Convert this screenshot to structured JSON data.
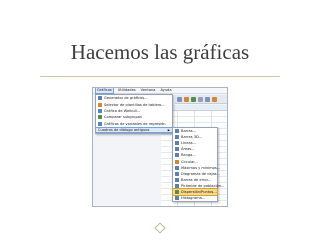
{
  "slide": {
    "title": "Hacemos las gráficas"
  },
  "menubar": {
    "items": [
      "Gráficos",
      "Utilidades",
      "Ventana",
      "Ayuda"
    ]
  },
  "graphs_menu": {
    "items": [
      {
        "label": "Generador de gráficos...",
        "icon": "chart-builder-icon"
      },
      {
        "label": "Selector de plantillas de tablero...",
        "icon": "template-icon"
      },
      {
        "label": "Gráfico de Weibull...",
        "icon": "weibull-icon"
      },
      {
        "label": "Comparar subgrupos",
        "icon": "compare-icon"
      },
      {
        "label": "Gráficos de variables de regresión",
        "icon": "regression-icon"
      },
      {
        "label": "Cuadros de diálogo antiguos",
        "has_submenu": true
      }
    ]
  },
  "legacy_submenu": {
    "items": [
      {
        "label": "Barras...",
        "icon": "bar-chart-icon"
      },
      {
        "label": "Barras 3D...",
        "icon": "bar-3d-icon"
      },
      {
        "label": "Líneas...",
        "icon": "line-chart-icon"
      },
      {
        "label": "Áreas...",
        "icon": "area-chart-icon"
      },
      {
        "label": "Rango...",
        "icon": "range-icon"
      },
      {
        "label": "Circular...",
        "icon": "pie-chart-icon"
      },
      {
        "label": "Máximos y mínimos...",
        "icon": "high-low-icon"
      },
      {
        "label": "Diagramas de cajas...",
        "icon": "boxplot-icon"
      },
      {
        "label": "Barras de error...",
        "icon": "error-bar-icon"
      },
      {
        "label": "Pirámide de población...",
        "icon": "population-pyramid-icon"
      },
      {
        "label": "Dispersión/Puntos...",
        "icon": "scatter-icon"
      },
      {
        "label": "Histograma...",
        "icon": "histogram-icon"
      }
    ],
    "selected_index": 10
  },
  "colors": {
    "highlight": "#dbe8fb",
    "selected": "#f9d98a",
    "title_rule": "#d9c7a6"
  }
}
